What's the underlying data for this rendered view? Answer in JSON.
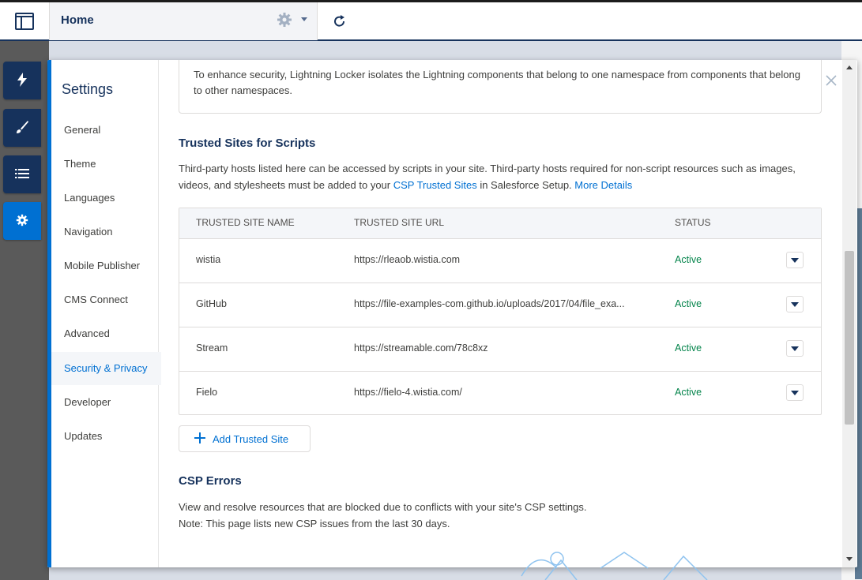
{
  "topbar": {
    "home_label": "Home",
    "icons": [
      "layout-icon",
      "gear-icon",
      "chevron-down-icon",
      "refresh-icon"
    ]
  },
  "rail": {
    "items": [
      {
        "name": "components",
        "icon": "lightning-icon",
        "active": false
      },
      {
        "name": "theme",
        "icon": "brush-icon",
        "active": false
      },
      {
        "name": "page-structure",
        "icon": "list-icon",
        "active": false
      },
      {
        "name": "settings",
        "icon": "gear-icon",
        "active": true
      }
    ]
  },
  "settings": {
    "title": "Settings",
    "nav": [
      {
        "label": "General"
      },
      {
        "label": "Theme"
      },
      {
        "label": "Languages"
      },
      {
        "label": "Navigation"
      },
      {
        "label": "Mobile Publisher"
      },
      {
        "label": "CMS Connect"
      },
      {
        "label": "Advanced"
      },
      {
        "label": "Security & Privacy"
      },
      {
        "label": "Developer"
      },
      {
        "label": "Updates"
      }
    ],
    "selected": "Security & Privacy"
  },
  "content": {
    "locker_text": "To enhance security, Lightning Locker isolates the Lightning components that belong to one namespace from components that belong to other namespaces.",
    "trusted_title": "Trusted Sites for Scripts",
    "trusted_desc_1": "Third-party hosts listed here can be accessed by scripts in your site. Third-party hosts required for non-script resources such as images, videos, and stylesheets must be added to your ",
    "trusted_link_csp": "CSP Trusted Sites",
    "trusted_desc_2": " in Salesforce Setup. ",
    "trusted_link_more": "More Details",
    "table": {
      "headers": {
        "name": "TRUSTED SITE NAME",
        "url": "TRUSTED SITE URL",
        "status": "STATUS"
      },
      "rows": [
        {
          "name": "wistia",
          "url": "https://rleaob.wistia.com",
          "status": "Active"
        },
        {
          "name": "GitHub",
          "url": "https://file-examples-com.github.io/uploads/2017/04/file_exa...",
          "status": "Active"
        },
        {
          "name": "Stream",
          "url": "https://streamable.com/78c8xz",
          "status": "Active"
        },
        {
          "name": "Fielo",
          "url": "https://fielo-4.wistia.com/",
          "status": "Active"
        }
      ]
    },
    "add_button": "Add Trusted Site",
    "csp_title": "CSP Errors",
    "csp_desc_1": "View and resolve resources that are blocked due to conflicts with your site's CSP settings.",
    "csp_desc_2": "Note: This page lists new CSP issues from the last 30 days."
  },
  "colors": {
    "brand": "#0070d2",
    "navy": "#16325c",
    "active_status": "#04844b"
  }
}
